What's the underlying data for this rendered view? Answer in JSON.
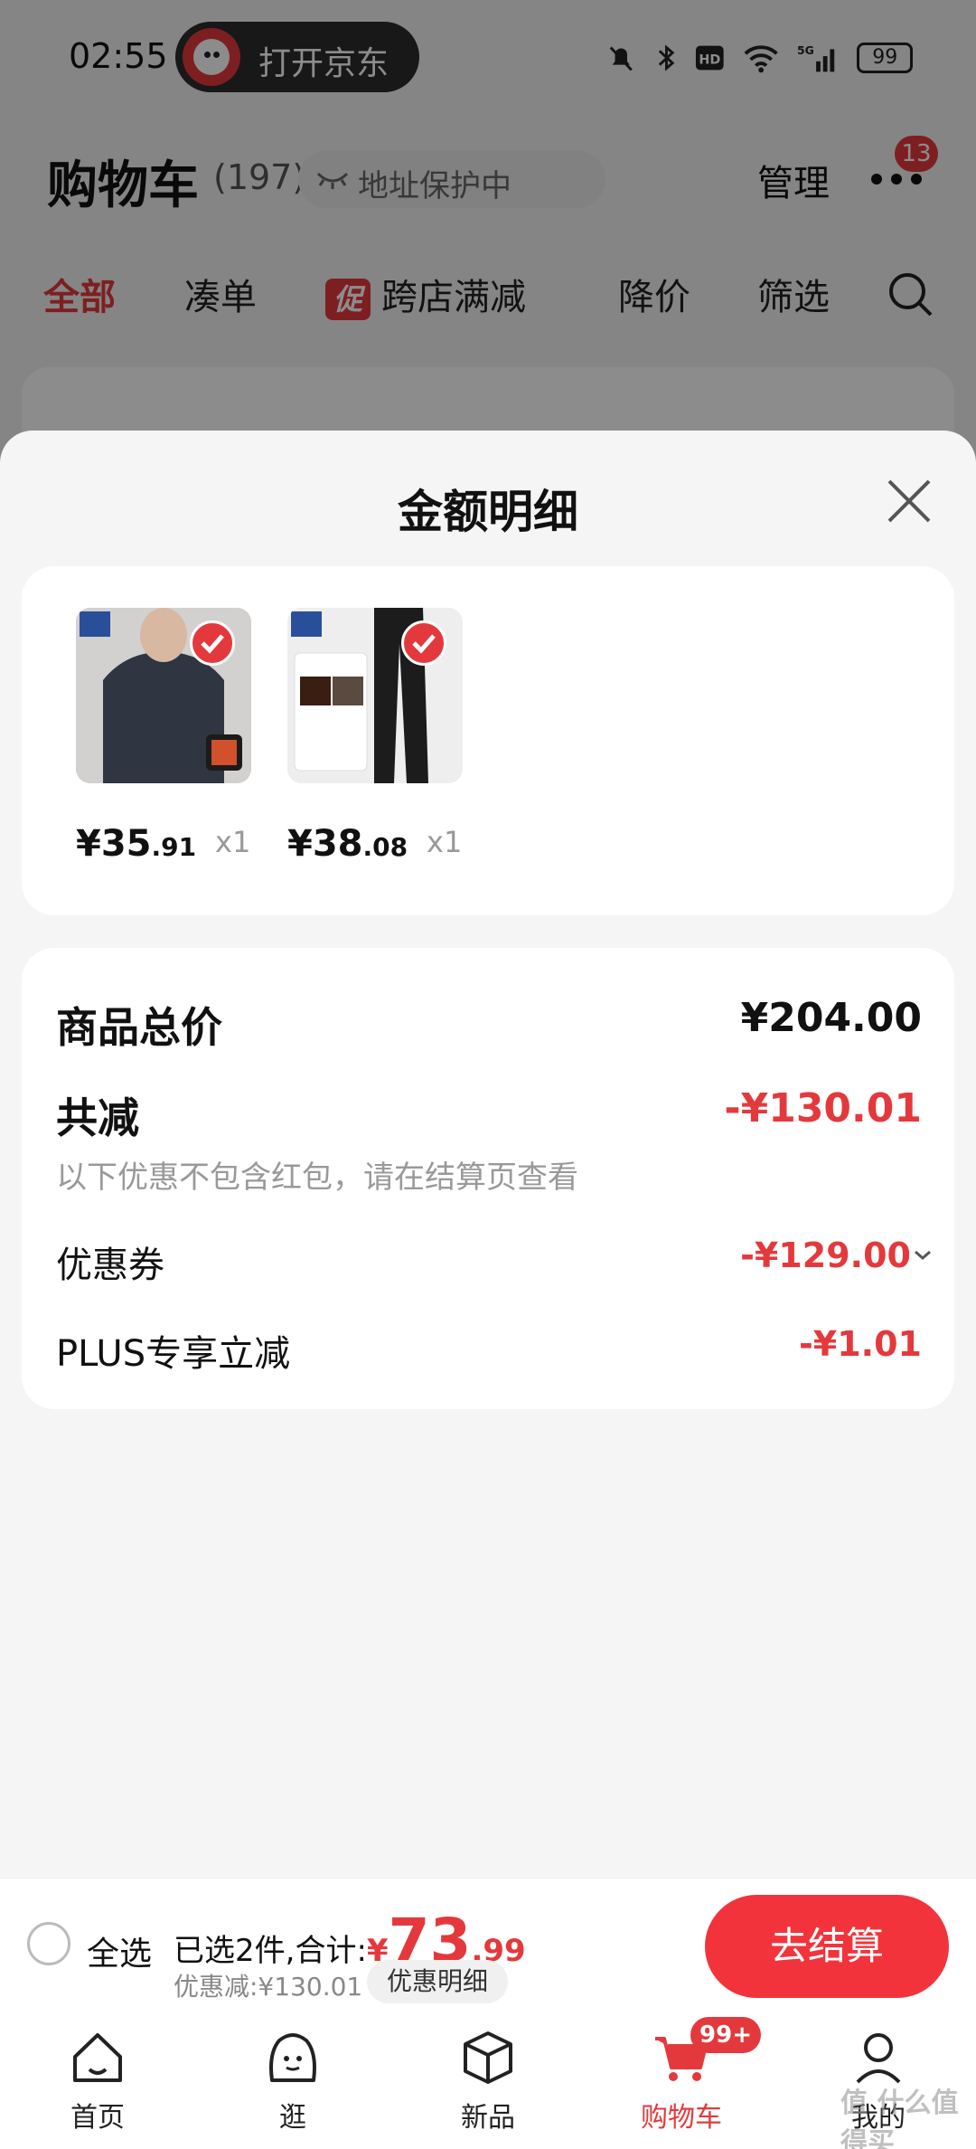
{
  "status_bar": {
    "time": "02:55",
    "jd_open": "打开京东",
    "network": "5G",
    "battery": "99"
  },
  "cart": {
    "title": "购物车",
    "count": "(197)",
    "address": "地址保护中",
    "manage": "管理",
    "notif_badge": "13"
  },
  "filters": [
    "全部",
    "凑单",
    "跨店满减",
    "降价",
    "筛选"
  ],
  "promo_tag": "促",
  "sheet": {
    "title": "金额明细",
    "products": [
      {
        "price_int": "¥35",
        "price_dec": ".91",
        "qty": "x1"
      },
      {
        "price_int": "¥38",
        "price_dec": ".08",
        "qty": "x1"
      }
    ],
    "rows": {
      "total_label": "商品总价",
      "total_value": "¥204.00",
      "reduce_label": "共减",
      "reduce_value": "-¥130.01",
      "reduce_note": "以下优惠不包含红包，请在结算页查看",
      "coupon_label": "优惠券",
      "coupon_value": "-¥129.00",
      "plus_label": "PLUS专享立减",
      "plus_value": "-¥1.01"
    }
  },
  "checkout": {
    "select_all": "全选",
    "selected_text": "已选2件,合计:",
    "currency": "¥",
    "total_int": "73",
    "total_dec": ".99",
    "discount_text": "优惠减:¥130.01",
    "discount_detail": "优惠明细",
    "go_checkout": "去结算"
  },
  "tabbar": {
    "items": [
      "首页",
      "逛",
      "新品",
      "购物车",
      "我的"
    ],
    "cart_badge": "99+"
  },
  "watermark": "值 什么值得买",
  "colors": {
    "accent": "#e4393c"
  }
}
